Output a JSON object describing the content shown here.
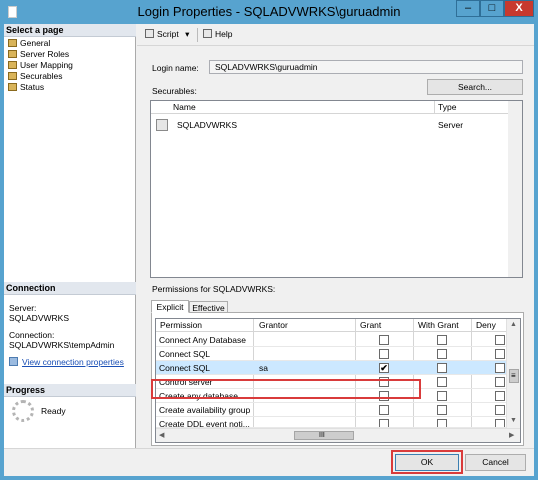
{
  "window": {
    "title": "Login Properties - SQLADVWRKS\\guruadmin",
    "minimize": "–",
    "maximize": "□",
    "close": "X"
  },
  "left_panel": {
    "select_page_heading": "Select a page",
    "pages": [
      {
        "label": "General"
      },
      {
        "label": "Server Roles"
      },
      {
        "label": "User Mapping"
      },
      {
        "label": "Securables",
        "selected": true
      },
      {
        "label": "Status"
      }
    ],
    "connection_heading": "Connection",
    "server_label": "Server:",
    "server_value": "SQLADVWRKS",
    "connection_label": "Connection:",
    "connection_value": "SQLADVWRKS\\tempAdmin",
    "view_connection_link": "View connection properties",
    "progress_heading": "Progress",
    "progress_status": "Ready"
  },
  "toolbar": {
    "script_label": "Script",
    "script_dropdown": "▾",
    "help_label": "Help"
  },
  "form": {
    "login_name_label": "Login name:",
    "login_name_value": "SQLADVWRKS\\guruadmin",
    "securables_label": "Securables:",
    "search_button": "Search..."
  },
  "securables_table": {
    "columns": [
      "Name",
      "Type"
    ],
    "rows": [
      {
        "name": "SQLADVWRKS",
        "type": "Server"
      }
    ]
  },
  "permissions": {
    "label": "Permissions for SQLADVWRKS:",
    "tabs": [
      {
        "label": "Explicit",
        "active": true
      },
      {
        "label": "Effective",
        "active": false
      }
    ],
    "columns": [
      "Permission",
      "Grantor",
      "Grant",
      "With Grant",
      "Deny"
    ],
    "rows": [
      {
        "permission": "Connect Any Database",
        "grantor": "",
        "grant": false,
        "with_grant": false,
        "deny": false
      },
      {
        "permission": "Connect SQL",
        "grantor": "",
        "grant": false,
        "with_grant": false,
        "deny": false
      },
      {
        "permission": "Connect SQL",
        "grantor": "sa",
        "grant": true,
        "with_grant": false,
        "deny": false,
        "selected": true
      },
      {
        "permission": "Control server",
        "grantor": "",
        "grant": false,
        "with_grant": false,
        "deny": false
      },
      {
        "permission": "Create any database",
        "grantor": "",
        "grant": false,
        "with_grant": false,
        "deny": false
      },
      {
        "permission": "Create availability group",
        "grantor": "",
        "grant": false,
        "with_grant": false,
        "deny": false
      },
      {
        "permission": "Create DDL event noti...",
        "grantor": "",
        "grant": false,
        "with_grant": false,
        "deny": false
      }
    ],
    "check_mark": "✔",
    "scroll_thumb_glyph": "≡",
    "hscroll_thumb_glyph": "III"
  },
  "buttons": {
    "ok": "OK",
    "cancel": "Cancel"
  },
  "colors": {
    "title_bar": "#57a3cf",
    "close_button": "#c7392e",
    "highlight": "#d93b3b",
    "selected_row": "#cce8ff",
    "link": "#1a4fb5"
  }
}
